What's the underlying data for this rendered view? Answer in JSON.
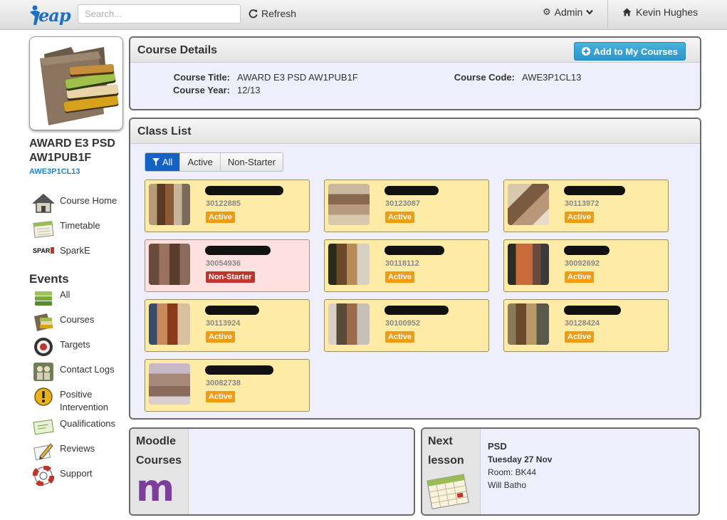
{
  "topbar": {
    "logo_text": "eap",
    "search_placeholder": "Search...",
    "refresh_label": "Refresh",
    "admin_label": "Admin",
    "user_name": "Kevin Hughes"
  },
  "sidebar": {
    "course_name": "AWARD E3 PSD AW1PUB1F",
    "course_code": "AWE3P1CL13",
    "nav": [
      {
        "label": "Course Home",
        "icon": "house-icon"
      },
      {
        "label": "Timetable",
        "icon": "calendar-icon"
      },
      {
        "label": "SparkE",
        "icon": "sparke-logo-icon"
      }
    ],
    "events_title": "Events",
    "events": [
      {
        "label": "All",
        "icon": "stack-icon"
      },
      {
        "label": "Courses",
        "icon": "books-icon"
      },
      {
        "label": "Targets",
        "icon": "target-icon"
      },
      {
        "label": "Contact Logs",
        "icon": "people-icon"
      },
      {
        "label": "Positive Intervention",
        "icon": "exclamation-icon"
      },
      {
        "label": "Qualifications",
        "icon": "certificate-icon"
      },
      {
        "label": "Reviews",
        "icon": "pencil-paper-icon"
      },
      {
        "label": "Support",
        "icon": "lifebuoy-icon"
      }
    ]
  },
  "course_details": {
    "title": "Course Details",
    "add_button": "Add to My Courses",
    "course_title_label": "Course Title:",
    "course_title_value": "AWARD E3 PSD AW1PUB1F",
    "course_year_label": "Course Year:",
    "course_year_value": "12/13",
    "course_code_label": "Course Code:",
    "course_code_value": "AWE3P1CL13"
  },
  "class_list": {
    "title": "Class List",
    "filters": [
      "All",
      "Active",
      "Non-Starter"
    ],
    "active_filter": "All",
    "students": [
      {
        "id": "30122885",
        "status": "Active"
      },
      {
        "id": "30123087",
        "status": "Active"
      },
      {
        "id": "30113972",
        "status": "Active"
      },
      {
        "id": "30054936",
        "status": "Non-Starter"
      },
      {
        "id": "30118112",
        "status": "Active"
      },
      {
        "id": "30092692",
        "status": "Active"
      },
      {
        "id": "30113924",
        "status": "Active"
      },
      {
        "id": "30100952",
        "status": "Active"
      },
      {
        "id": "30128424",
        "status": "Active"
      },
      {
        "id": "30082738",
        "status": "Active"
      }
    ]
  },
  "moodle": {
    "label_line1": "Moodle",
    "label_line2": "Courses",
    "logo_letter": "m"
  },
  "next_lesson": {
    "label_line1": "Next",
    "label_line2": "lesson",
    "subject": "PSD",
    "date": "Tuesday 27 Nov",
    "room": "Room: BK44",
    "teacher": "Will Batho"
  },
  "colors": {
    "accent": "#1a87c9",
    "card_active": "#fdeba6",
    "card_nonstarter": "#fde0e0",
    "badge_active": "#f09b14",
    "badge_nonstarter": "#c0342b",
    "filter_selected": "#1562c4",
    "moodle_purple": "#7b3f9b"
  }
}
